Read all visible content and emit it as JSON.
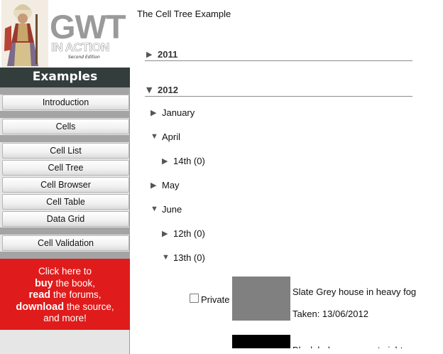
{
  "sidebar": {
    "logo": {
      "title": "GWT",
      "subtitle": "IN ACTION",
      "edition": "Second Edition"
    },
    "heading": "Examples",
    "nav": {
      "introduction": "Introduction",
      "cells": "Cells",
      "cell_list": "Cell List",
      "cell_tree": "Cell Tree",
      "cell_browser": "Cell Browser",
      "cell_table": "Cell Table",
      "data_grid": "Data Grid",
      "cell_validation": "Cell Validation"
    },
    "promo": {
      "line1": "Click here to",
      "buy": "buy",
      "buy_rest": " the book,",
      "read": "read",
      "read_rest": " the forums,",
      "download": "download",
      "download_rest": " the source,",
      "line5": "and more!"
    }
  },
  "main": {
    "title": "The Cell Tree Example",
    "years": {
      "y2011": "2011",
      "y2012": "2012"
    },
    "months": {
      "january": "January",
      "april": "April",
      "may": "May",
      "june": "June"
    },
    "days": {
      "apr14": "14th (0)",
      "jun12": "12th (0)",
      "jun13": "13th (0)"
    },
    "photos": [
      {
        "private_label": "Private",
        "caption": "Slate Grey house in heavy fog",
        "taken": "Taken: 13/06/2012",
        "color": "#808080"
      },
      {
        "caption": "Black hole as seen at night",
        "color": "#000000"
      }
    ]
  },
  "icons": {
    "collapsed": "triangle-right",
    "expanded": "triangle-down"
  }
}
